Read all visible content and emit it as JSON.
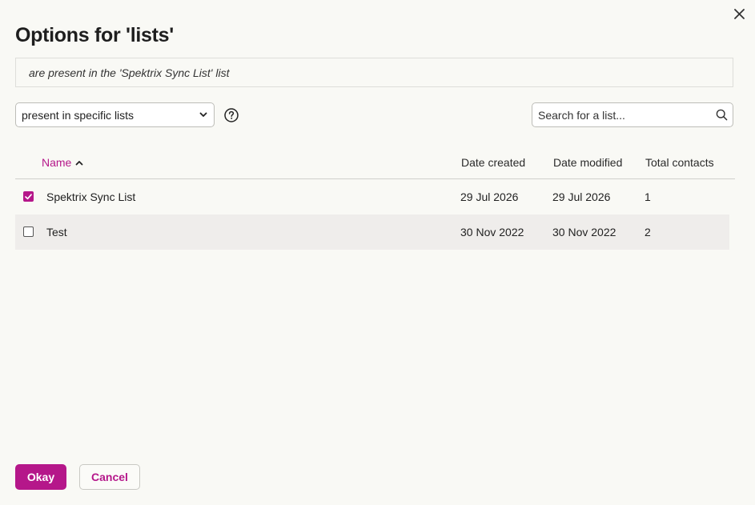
{
  "dialog": {
    "title": "Options for 'lists'",
    "summary": "are present in the 'Spektrix Sync List' list"
  },
  "filter": {
    "selected": "present in specific lists"
  },
  "search": {
    "placeholder": "Search for a list..."
  },
  "table": {
    "columns": {
      "name": "Name",
      "date_created": "Date created",
      "date_modified": "Date modified",
      "total_contacts": "Total contacts"
    },
    "sort": {
      "column": "Name",
      "direction": "ascending"
    },
    "rows": [
      {
        "checked": true,
        "name": "Spektrix Sync List",
        "date_created": "29 Jul 2026",
        "date_modified": "29 Jul 2026",
        "total_contacts": "1"
      },
      {
        "checked": false,
        "name": "Test",
        "date_created": "30 Nov 2022",
        "date_modified": "30 Nov 2022",
        "total_contacts": "2"
      }
    ]
  },
  "footer": {
    "okay_label": "Okay",
    "cancel_label": "Cancel"
  },
  "colors": {
    "accent": "#b5178a",
    "background": "#f9f9f5",
    "row_alt": "#efedeb"
  }
}
